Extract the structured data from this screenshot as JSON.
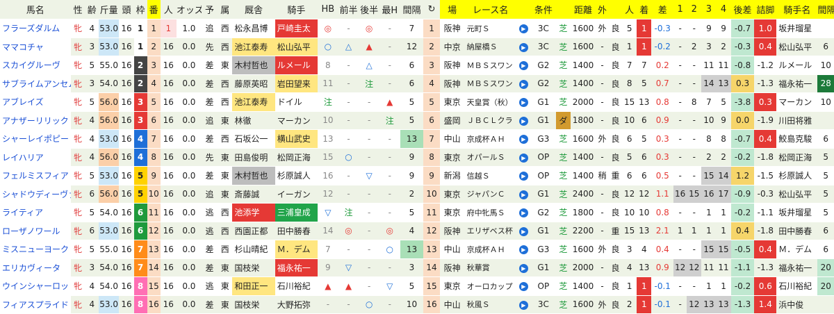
{
  "headers": [
    "馬名",
    "性",
    "齢",
    "斤量",
    "頭",
    "枠",
    "番",
    "人",
    "オッズ",
    "予",
    "属",
    "厩舎",
    "騎手",
    "HB",
    "前半",
    "後半",
    "最H",
    "間隔",
    "↻",
    "場",
    "レース名",
    "",
    "条件",
    "",
    "距離",
    "外",
    "",
    "人",
    "着",
    "差",
    "1",
    "2",
    "3",
    "4",
    "後差",
    "詰脚",
    "騎手名",
    "間隔"
  ],
  "header_yellow": [
    false,
    false,
    false,
    false,
    false,
    false,
    true,
    false,
    false,
    false,
    false,
    false,
    false,
    false,
    false,
    false,
    false,
    false,
    false,
    true,
    true,
    true,
    true,
    true,
    true,
    true,
    true,
    true,
    true,
    true,
    true,
    true,
    true,
    true,
    true,
    true,
    true,
    true
  ],
  "arrow_glyph": "▶",
  "rows": [
    {
      "name": "フラーズダルム",
      "sex": "牝",
      "age": "4",
      "weight": "53.0",
      "heads": "16",
      "waku": "1",
      "ban": "1",
      "pop": "1",
      "odds": "1.0",
      "yo": "追",
      "zoku": "西",
      "trainer": "松永昌博",
      "jockey": "戸崎圭太",
      "hb": "◎",
      "front": "-",
      "back": "◎",
      "maxh": "-",
      "interval": "7",
      "lap": "1",
      "venue": "阪神",
      "race": "元町Ｓ",
      "cls": "3C",
      "surf": "芝",
      "dist": "1600",
      "out": "外",
      "going": "良",
      "rpop": "5",
      "rank": "1",
      "diff": "-0.3",
      "c1": "-",
      "c2": "-",
      "c3": "9",
      "c4": "9",
      "late": "-0.7",
      "tsume": "1.0",
      "jname": "坂井瑠星",
      "jint": ""
    },
    {
      "name": "ママコチャ",
      "sex": "牝",
      "age": "3",
      "weight": "53.0",
      "heads": "16",
      "waku": "1",
      "ban": "2",
      "pop": "16",
      "odds": "0.0",
      "yo": "先",
      "zoku": "西",
      "trainer": "池江泰寿",
      "jockey": "松山弘平",
      "hb": "○",
      "front": "△",
      "back": "▲",
      "maxh": "-",
      "interval": "12",
      "lap": "2",
      "venue": "中京",
      "race": "納屋橋Ｓ",
      "cls": "3C",
      "surf": "芝",
      "dist": "1600",
      "out": "-",
      "going": "良",
      "rpop": "1",
      "rank": "1",
      "diff": "-0.2",
      "c1": "-",
      "c2": "2",
      "c3": "3",
      "c4": "2",
      "late": "-0.3",
      "tsume": "0.4",
      "jname": "松山弘平",
      "jint": "6"
    },
    {
      "name": "スカイグルーヴ",
      "sex": "牝",
      "age": "5",
      "weight": "55.0",
      "heads": "16",
      "waku": "2",
      "ban": "3",
      "pop": "16",
      "odds": "0.0",
      "yo": "差",
      "zoku": "東",
      "trainer": "木村哲也",
      "jockey": "ルメール",
      "hb": "8",
      "front": "-",
      "back": "△",
      "maxh": "-",
      "interval": "6",
      "lap": "3",
      "venue": "阪神",
      "race": "ＭＢＳスワン",
      "cls": "G2",
      "surf": "芝",
      "dist": "1400",
      "out": "-",
      "going": "良",
      "rpop": "7",
      "rank": "7",
      "diff": "0.2",
      "c1": "-",
      "c2": "-",
      "c3": "11",
      "c4": "11",
      "late": "-0.8",
      "tsume": "-1.2",
      "jname": "ルメール",
      "jint": "10"
    },
    {
      "name": "サブライムアンセム",
      "sex": "牝",
      "age": "3",
      "weight": "54.0",
      "heads": "16",
      "waku": "2",
      "ban": "4",
      "pop": "16",
      "odds": "0.0",
      "yo": "差",
      "zoku": "西",
      "trainer": "藤原英昭",
      "jockey": "岩田望来",
      "hb": "11",
      "front": "-",
      "back": "注",
      "maxh": "-",
      "interval": "6",
      "lap": "4",
      "venue": "阪神",
      "race": "ＭＢＳスワン",
      "cls": "G2",
      "surf": "芝",
      "dist": "1400",
      "out": "-",
      "going": "良",
      "rpop": "8",
      "rank": "5",
      "diff": "0.7",
      "c1": "-",
      "c2": "-",
      "c3": "14",
      "c4": "13",
      "late": "0.3",
      "tsume": "-1.3",
      "jname": "福永祐一",
      "jint": "28"
    },
    {
      "name": "アブレイズ",
      "sex": "牝",
      "age": "5",
      "weight": "56.0",
      "heads": "16",
      "waku": "3",
      "ban": "5",
      "pop": "16",
      "odds": "0.0",
      "yo": "差",
      "zoku": "西",
      "trainer": "池江泰寿",
      "jockey": "ドイル",
      "hb": "注",
      "front": "-",
      "back": "-",
      "maxh": "▲",
      "interval": "5",
      "lap": "5",
      "venue": "東京",
      "race": "天皇賞（秋）",
      "cls": "G1",
      "surf": "芝",
      "dist": "2000",
      "out": "-",
      "going": "良",
      "rpop": "15",
      "rank": "13",
      "diff": "0.8",
      "c1": "-",
      "c2": "8",
      "c3": "7",
      "c4": "5",
      "late": "-3.8",
      "tsume": "0.3",
      "jname": "マーカン",
      "jint": "10"
    },
    {
      "name": "アナザーリリック",
      "sex": "牝",
      "age": "4",
      "weight": "56.0",
      "heads": "16",
      "waku": "3",
      "ban": "6",
      "pop": "16",
      "odds": "0.0",
      "yo": "追",
      "zoku": "東",
      "trainer": "林徹",
      "jockey": "マーカン",
      "hb": "10",
      "front": "-",
      "back": "-",
      "maxh": "注",
      "interval": "5",
      "lap": "6",
      "venue": "盛岡",
      "race": "ＪＢＣＬクラ",
      "cls": "G1",
      "surf": "ダ",
      "dist": "1800",
      "out": "-",
      "going": "良",
      "rpop": "10",
      "rank": "6",
      "diff": "0.9",
      "c1": "-",
      "c2": "-",
      "c3": "10",
      "c4": "9",
      "late": "0.0",
      "tsume": "-1.9",
      "jname": "川田将雅",
      "jint": ""
    },
    {
      "name": "シャーレイポピー",
      "sex": "牝",
      "age": "4",
      "weight": "53.0",
      "heads": "16",
      "waku": "4",
      "ban": "7",
      "pop": "16",
      "odds": "0.0",
      "yo": "差",
      "zoku": "西",
      "trainer": "石坂公一",
      "jockey": "横山武史",
      "hb": "13",
      "front": "-",
      "back": "-",
      "maxh": "-",
      "interval": "13",
      "lap": "7",
      "venue": "中山",
      "race": "京成杯ＡＨ",
      "cls": "G3",
      "surf": "芝",
      "dist": "1600",
      "out": "外",
      "going": "良",
      "rpop": "6",
      "rank": "5",
      "diff": "0.3",
      "c1": "-",
      "c2": "-",
      "c3": "8",
      "c4": "8",
      "late": "-0.7",
      "tsume": "0.4",
      "jname": "鮫島克駿",
      "jint": "6"
    },
    {
      "name": "レイハリア",
      "sex": "牝",
      "age": "4",
      "weight": "56.0",
      "heads": "16",
      "waku": "4",
      "ban": "8",
      "pop": "16",
      "odds": "0.0",
      "yo": "先",
      "zoku": "東",
      "trainer": "田島俊明",
      "jockey": "松岡正海",
      "hb": "15",
      "front": "○",
      "back": "-",
      "maxh": "-",
      "interval": "9",
      "lap": "8",
      "venue": "東京",
      "race": "オパールＳ",
      "cls": "OP",
      "surf": "芝",
      "dist": "1400",
      "out": "-",
      "going": "良",
      "rpop": "5",
      "rank": "6",
      "diff": "0.3",
      "c1": "-",
      "c2": "-",
      "c3": "2",
      "c4": "2",
      "late": "-0.2",
      "tsume": "-1.8",
      "jname": "松岡正海",
      "jint": "5"
    },
    {
      "name": "フェルミスフィア",
      "sex": "牝",
      "age": "5",
      "weight": "53.0",
      "heads": "16",
      "waku": "5",
      "ban": "9",
      "pop": "16",
      "odds": "0.0",
      "yo": "差",
      "zoku": "東",
      "trainer": "木村哲也",
      "jockey": "杉原誠人",
      "hb": "16",
      "front": "-",
      "back": "▽",
      "maxh": "-",
      "interval": "9",
      "lap": "9",
      "venue": "新潟",
      "race": "信越Ｓ",
      "cls": "OP",
      "surf": "芝",
      "dist": "1400",
      "out": "稍",
      "going": "重",
      "rpop": "6",
      "rank": "6",
      "diff": "0.5",
      "c1": "-",
      "c2": "-",
      "c3": "15",
      "c4": "14",
      "late": "1.2",
      "tsume": "-1.5",
      "jname": "杉原誠人",
      "jint": "5"
    },
    {
      "name": "シャドウディーヴァ",
      "sex": "牝",
      "age": "6",
      "weight": "56.0",
      "heads": "16",
      "waku": "5",
      "ban": "10",
      "pop": "16",
      "odds": "0.0",
      "yo": "追",
      "zoku": "東",
      "trainer": "斎藤誠",
      "jockey": "イーガン",
      "hb": "12",
      "front": "-",
      "back": "-",
      "maxh": "-",
      "interval": "2",
      "lap": "10",
      "venue": "東京",
      "race": "ジャパンＣ",
      "cls": "G1",
      "surf": "芝",
      "dist": "2400",
      "out": "-",
      "going": "良",
      "rpop": "12",
      "rank": "12",
      "diff": "1.1",
      "c1": "16",
      "c2": "15",
      "c3": "16",
      "c4": "17",
      "late": "-0.9",
      "tsume": "-0.3",
      "jname": "松山弘平",
      "jint": "5"
    },
    {
      "name": "ライティア",
      "sex": "牝",
      "age": "5",
      "weight": "54.0",
      "heads": "16",
      "waku": "6",
      "ban": "11",
      "pop": "16",
      "odds": "0.0",
      "yo": "逃",
      "zoku": "西",
      "trainer": "池添学",
      "jockey": "三浦皇成",
      "hb": "▽",
      "front": "注",
      "back": "-",
      "maxh": "-",
      "interval": "5",
      "lap": "11",
      "venue": "東京",
      "race": "府中牝馬Ｓ",
      "cls": "G2",
      "surf": "芝",
      "dist": "1800",
      "out": "-",
      "going": "良",
      "rpop": "10",
      "rank": "10",
      "diff": "0.8",
      "c1": "-",
      "c2": "-",
      "c3": "1",
      "c4": "1",
      "late": "-0.2",
      "tsume": "-1.1",
      "jname": "坂井瑠星",
      "jint": "5"
    },
    {
      "name": "ローザノワール",
      "sex": "牝",
      "age": "6",
      "weight": "53.0",
      "heads": "16",
      "waku": "6",
      "ban": "12",
      "pop": "16",
      "odds": "0.0",
      "yo": "逃",
      "zoku": "西",
      "trainer": "西園正都",
      "jockey": "田中勝春",
      "hb": "14",
      "front": "◎",
      "back": "-",
      "maxh": "◎",
      "interval": "4",
      "lap": "12",
      "venue": "阪神",
      "race": "エリザベス杯",
      "cls": "G1",
      "surf": "芝",
      "dist": "2200",
      "out": "-",
      "going": "重",
      "rpop": "15",
      "rank": "13",
      "diff": "2.1",
      "c1": "1",
      "c2": "1",
      "c3": "1",
      "c4": "1",
      "late": "0.4",
      "tsume": "-1.8",
      "jname": "田中勝春",
      "jint": "6"
    },
    {
      "name": "ミスニューヨーク",
      "sex": "牝",
      "age": "5",
      "weight": "55.0",
      "heads": "16",
      "waku": "7",
      "ban": "13",
      "pop": "16",
      "odds": "0.0",
      "yo": "差",
      "zoku": "西",
      "trainer": "杉山晴紀",
      "jockey": "Ｍ．デム",
      "hb": "7",
      "front": "-",
      "back": "-",
      "maxh": "○",
      "interval": "13",
      "lap": "13",
      "venue": "中山",
      "race": "京成杯ＡＨ",
      "cls": "G3",
      "surf": "芝",
      "dist": "1600",
      "out": "外",
      "going": "良",
      "rpop": "3",
      "rank": "4",
      "diff": "0.4",
      "c1": "-",
      "c2": "-",
      "c3": "15",
      "c4": "15",
      "late": "-0.5",
      "tsume": "0.4",
      "jname": "Ｍ．デム",
      "jint": "6"
    },
    {
      "name": "エリカヴィータ",
      "sex": "牝",
      "age": "3",
      "weight": "54.0",
      "heads": "16",
      "waku": "7",
      "ban": "14",
      "pop": "16",
      "odds": "0.0",
      "yo": "差",
      "zoku": "東",
      "trainer": "国枝栄",
      "jockey": "福永祐一",
      "hb": "9",
      "front": "▽",
      "back": "-",
      "maxh": "-",
      "interval": "3",
      "lap": "14",
      "venue": "阪神",
      "race": "秋華賞",
      "cls": "G1",
      "surf": "芝",
      "dist": "2000",
      "out": "-",
      "going": "良",
      "rpop": "4",
      "rank": "13",
      "diff": "0.9",
      "c1": "12",
      "c2": "12",
      "c3": "11",
      "c4": "11",
      "late": "-1.1",
      "tsume": "-1.3",
      "jname": "福永祐一",
      "jint": "20"
    },
    {
      "name": "ウインシャーロット",
      "sex": "牝",
      "age": "4",
      "weight": "54.0",
      "heads": "16",
      "waku": "8",
      "ban": "15",
      "pop": "16",
      "odds": "0.0",
      "yo": "逃",
      "zoku": "東",
      "trainer": "和田正一",
      "jockey": "石川裕紀",
      "hb": "▲",
      "front": "▲",
      "back": "-",
      "maxh": "▽",
      "interval": "5",
      "lap": "15",
      "venue": "東京",
      "race": "オーロカップ",
      "cls": "OP",
      "surf": "芝",
      "dist": "1400",
      "out": "-",
      "going": "良",
      "rpop": "1",
      "rank": "1",
      "diff": "-0.1",
      "c1": "-",
      "c2": "-",
      "c3": "1",
      "c4": "1",
      "late": "-0.2",
      "tsume": "0.6",
      "jname": "石川裕紀",
      "jint": "20"
    },
    {
      "name": "フィアスプライド",
      "sex": "牝",
      "age": "4",
      "weight": "53.0",
      "heads": "16",
      "waku": "8",
      "ban": "16",
      "pop": "16",
      "odds": "0.0",
      "yo": "差",
      "zoku": "東",
      "trainer": "国枝栄",
      "jockey": "大野拓弥",
      "hb": "-",
      "front": "-",
      "back": "○",
      "maxh": "-",
      "interval": "10",
      "lap": "16",
      "venue": "中山",
      "race": "秋風Ｓ",
      "cls": "3C",
      "surf": "芝",
      "dist": "1600",
      "out": "外",
      "going": "良",
      "rpop": "2",
      "rank": "1",
      "diff": "-0.1",
      "c1": "-",
      "c2": "12",
      "c3": "13",
      "c4": "13",
      "late": "-1.3",
      "tsume": "1.4",
      "jname": "浜中俊",
      "jint": ""
    }
  ]
}
